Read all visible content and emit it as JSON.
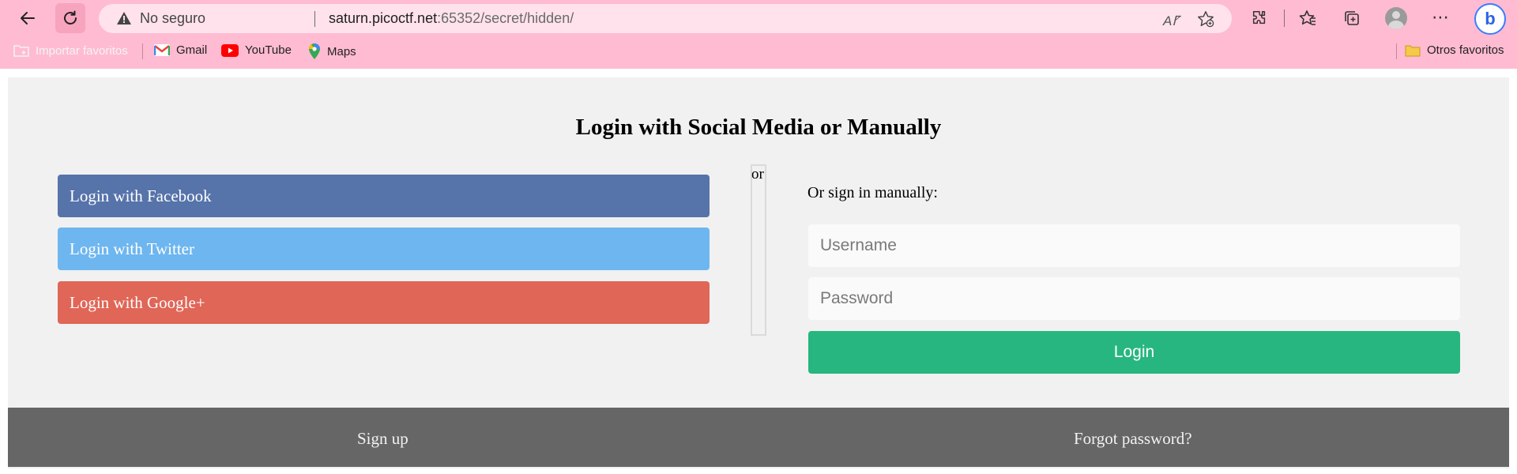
{
  "browser": {
    "back_icon": "back-arrow-icon",
    "reload_icon": "reload-icon",
    "security_label": "No seguro",
    "url_host": "saturn.picoctf.net",
    "url_rest": ":65352/secret/hidden/",
    "read_aloud": "A",
    "bookmarks": {
      "import_label": "Importar favoritos",
      "gmail_label": "Gmail",
      "youtube_label": "YouTube",
      "maps_label": "Maps",
      "others_label": "Otros favoritos"
    }
  },
  "page": {
    "title": "Login with Social Media or Manually",
    "social": {
      "facebook": "Login with Facebook",
      "twitter": "Login with Twitter",
      "google": "Login with Google+"
    },
    "divider_label": "or",
    "manual_hint": "Or sign in manually:",
    "username_placeholder": "Username",
    "password_placeholder": "Password",
    "login_label": "Login",
    "footer": {
      "signup": "Sign up",
      "forgot": "Forgot password?"
    }
  },
  "colors": {
    "chrome": "#ffbbd2",
    "facebook": "#5673aa",
    "twitter": "#6eb6ef",
    "google": "#e06657",
    "login": "#27b680",
    "footer": "#666666"
  }
}
